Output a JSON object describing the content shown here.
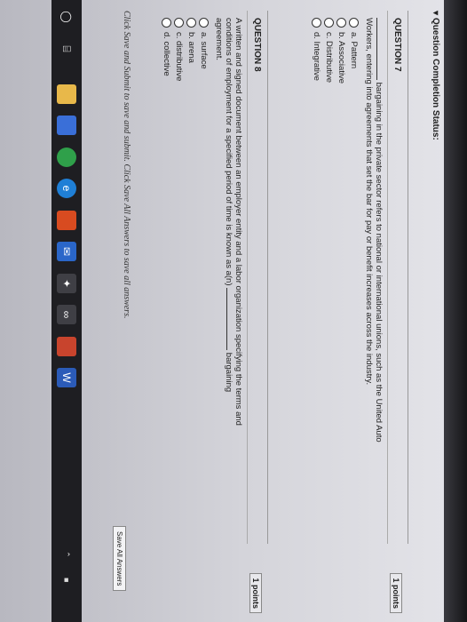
{
  "status_title": "Question Completion Status:",
  "q7": {
    "title": "QUESTION 7",
    "points": "1 points",
    "blank_text": "bargaining in the private sector refers to national or international unions, such as the United Auto",
    "text2": "Workers, entering into agreements that set the bar for pay or benefit increases across the industry.",
    "options": [
      "a. Pattern",
      "b. Associative",
      "c. Distributive",
      "d. Integrative"
    ]
  },
  "q8": {
    "title": "QUESTION 8",
    "points": "1 points",
    "text1": "A written and signed document between an employer entity and a labor organization specifying the terms and",
    "text2": "conditions of employment for a specified period of time is known as a(n)",
    "text3": "bargaining",
    "text4": "agreement.",
    "options": [
      "a. surface",
      "b. arena",
      "c. distributive",
      "d. collective"
    ]
  },
  "footer_note": "Click Save and Submit to save and submit. Click Save All Answers to save all answers.",
  "save_all_label": "Save All Answers",
  "taskbar": {
    "icons": [
      "windows-icon",
      "task-view-icon",
      "file-explorer-icon",
      "store-icon",
      "chrome-icon",
      "edge-icon",
      "office-icon",
      "mail-icon",
      "xbox-icon",
      "people-icon",
      "word-icon"
    ]
  }
}
